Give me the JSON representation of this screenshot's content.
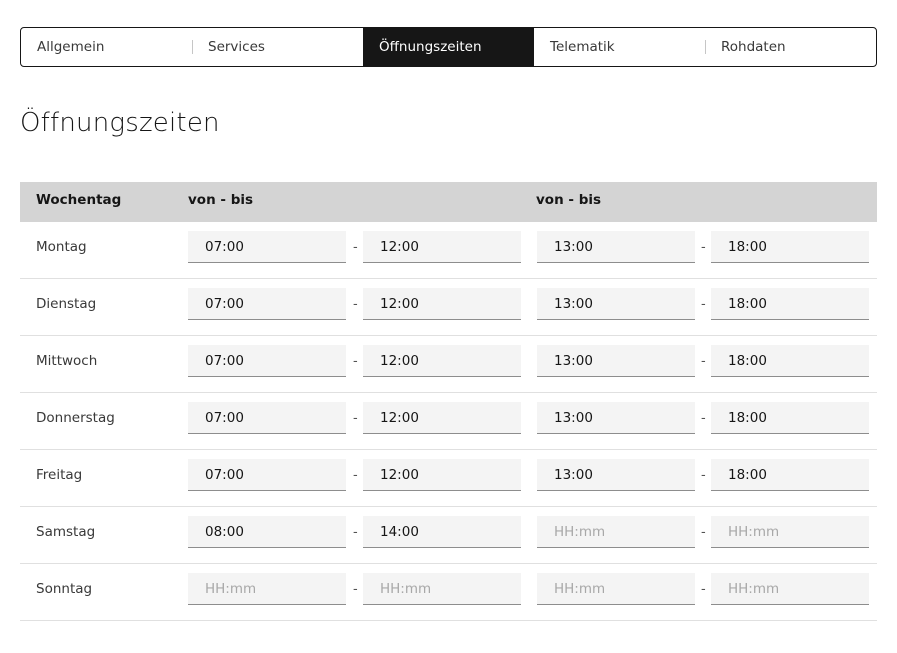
{
  "tabs": [
    {
      "label": "Allgemein",
      "active": false
    },
    {
      "label": "Services",
      "active": false
    },
    {
      "label": "Öffnungszeiten",
      "active": true
    },
    {
      "label": "Telematik",
      "active": false
    },
    {
      "label": "Rohdaten",
      "active": false
    }
  ],
  "page_title": "Öffnungszeiten",
  "table": {
    "headers": {
      "weekday": "Wochentag",
      "range1": "von - bis",
      "range2": "von - bis"
    },
    "separator": "-",
    "placeholder": "HH:mm",
    "rows": [
      {
        "day": "Montag",
        "from1": "07:00",
        "to1": "12:00",
        "from2": "13:00",
        "to2": "18:00"
      },
      {
        "day": "Dienstag",
        "from1": "07:00",
        "to1": "12:00",
        "from2": "13:00",
        "to2": "18:00"
      },
      {
        "day": "Mittwoch",
        "from1": "07:00",
        "to1": "12:00",
        "from2": "13:00",
        "to2": "18:00"
      },
      {
        "day": "Donnerstag",
        "from1": "07:00",
        "to1": "12:00",
        "from2": "13:00",
        "to2": "18:00"
      },
      {
        "day": "Freitag",
        "from1": "07:00",
        "to1": "12:00",
        "from2": "13:00",
        "to2": "18:00"
      },
      {
        "day": "Samstag",
        "from1": "08:00",
        "to1": "14:00",
        "from2": "",
        "to2": ""
      },
      {
        "day": "Sonntag",
        "from1": "",
        "to1": "",
        "from2": "",
        "to2": ""
      }
    ]
  }
}
